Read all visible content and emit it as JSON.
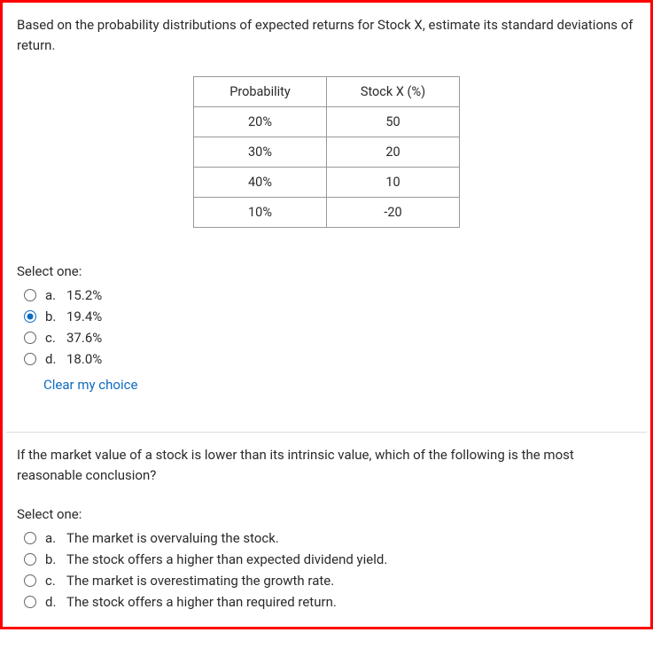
{
  "q1": {
    "text": "Based on the probability distributions of expected returns for Stock X, estimate its standard deviations of return.",
    "table": {
      "headers": [
        "Probability",
        "Stock X (%)"
      ],
      "rows": [
        [
          "20%",
          "50"
        ],
        [
          "30%",
          "20"
        ],
        [
          "40%",
          "10"
        ],
        [
          "10%",
          "-20"
        ]
      ]
    },
    "select_label": "Select one:",
    "options": [
      {
        "letter": "a.",
        "text": "15.2%",
        "selected": false
      },
      {
        "letter": "b.",
        "text": "19.4%",
        "selected": true
      },
      {
        "letter": "c.",
        "text": "37.6%",
        "selected": false
      },
      {
        "letter": "d.",
        "text": "18.0%",
        "selected": false
      }
    ],
    "clear": "Clear my choice"
  },
  "q2": {
    "text": "If the market value of a stock is lower than its intrinsic value, which of the following is the most reasonable conclusion?",
    "select_label": "Select one:",
    "options": [
      {
        "letter": "a.",
        "text": "The market is overvaluing the stock.",
        "selected": false
      },
      {
        "letter": "b.",
        "text": "The stock offers a higher than expected dividend yield.",
        "selected": false
      },
      {
        "letter": "c.",
        "text": "The market is overestimating the growth rate.",
        "selected": false
      },
      {
        "letter": "d.",
        "text": "The stock offers a higher than required return.",
        "selected": false
      }
    ]
  }
}
